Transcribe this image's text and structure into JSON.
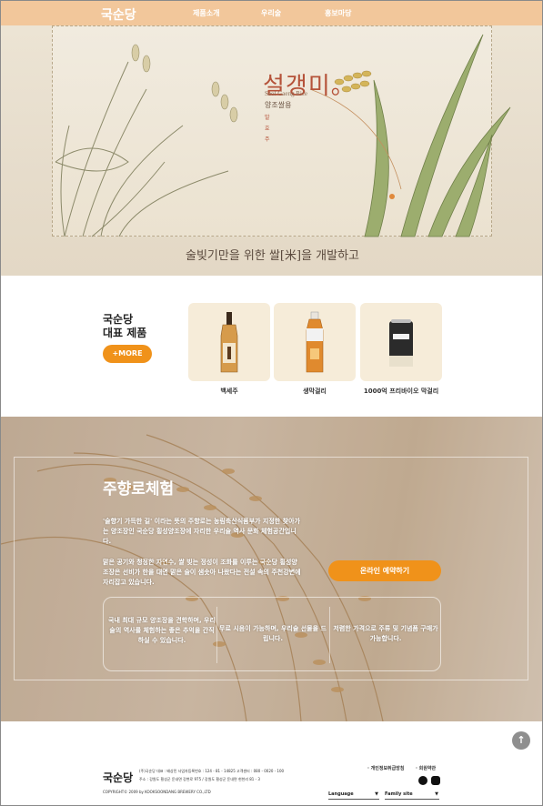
{
  "nav": {
    "logo": "국순당",
    "items": [
      "제품소개",
      "우리술",
      "홍보마당"
    ]
  },
  "hero": {
    "brand": "설갱미。",
    "brand_en": "Seol Gaeng Rice",
    "brand_kr": "양조쌀용",
    "seal": "발 효 주",
    "slogan": "술빚기만을 위한 쌀[米]을 개발하고"
  },
  "products": {
    "title_line1": "국순당",
    "title_line2": "대표 제품",
    "more_label": "+MORE",
    "items": [
      {
        "name": "백세주"
      },
      {
        "name": "생막걸리"
      },
      {
        "name": "1000억 프리바이오 막걸리"
      }
    ]
  },
  "experience": {
    "title": "주향로체험",
    "para1": "'술향기 가득한 길' 이라는 뜻의 주향로는 농림축산식품부가 지정한 찾아가는 양조장인 국순당 횡성양조장에 자리한 우리술 역사 문화 체험공간입니다.",
    "para2": "맑은 공기와 청정한 자연수, 쌀 빚는 정성이 조화를 이루는 국순당 횡성양조장은 선비가 한을 대면 맑은 술이 샘솟아 나왔다는 전설 속의 주천강변에 자리잡고 있습니다.",
    "reserve_label": "온라인 예약하기",
    "features": [
      "국내 최대 규모 양조장을 견학하며, 우리술의 역사를 체험하는 좋은 추억을 간직하실 수 있습니다.",
      "무료 시음이 가능하며, 우리술 선물을 드립니다.",
      "저렴한 가격으로 주류 및 기념품 구매가 가능합니다."
    ]
  },
  "footer": {
    "logo": "국순당",
    "line1": "(주)국순당    대표 : 배상민    사업자등록번호 : 124 - 81 - 14825    고객센터 : 080 - 0020 - 100",
    "line2": "주소 : 강원도 횡성군 둔내면 강변로 975 / 강원도 횡성군 둔내면 현천리 81 - 3",
    "copyright": "COPYRIGHT© 2009 by KOOKSOONDANG BREWERY CO.,LTD",
    "privacy": "· 개인정보취급방침",
    "terms": "· 회원약관",
    "language": "Language",
    "family": "Family site",
    "top_label": "↑"
  }
}
